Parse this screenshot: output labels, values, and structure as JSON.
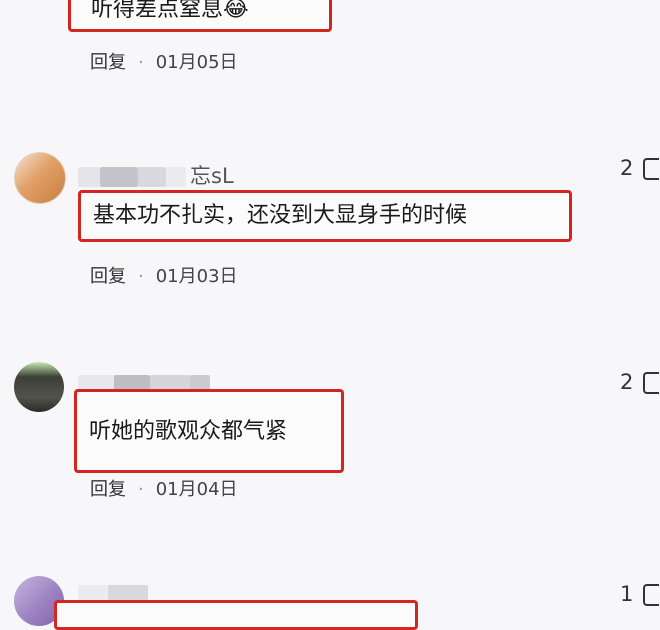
{
  "comments": [
    {
      "username": "",
      "text": "听得差点窒息😂",
      "reply_label": "回复",
      "date": "01月05日",
      "likes": "",
      "avatar_color": "#cfcfd4"
    },
    {
      "username": "忘sL",
      "text": "基本功不扎实，还没到大显身手的时候",
      "reply_label": "回复",
      "date": "01月03日",
      "likes": "2",
      "avatar_color": "#e0a068"
    },
    {
      "username": "",
      "text": "听她的歌观众都气紧",
      "reply_label": "回复",
      "date": "01月04日",
      "likes": "2",
      "avatar_color": "#3a3f36"
    },
    {
      "username": "",
      "text": "",
      "reply_label": "",
      "date": "",
      "likes": "1",
      "avatar_color": "#9a7ec0"
    }
  ],
  "colors": {
    "highlight_border": "#d3261f",
    "background": "#f7f7f9"
  }
}
